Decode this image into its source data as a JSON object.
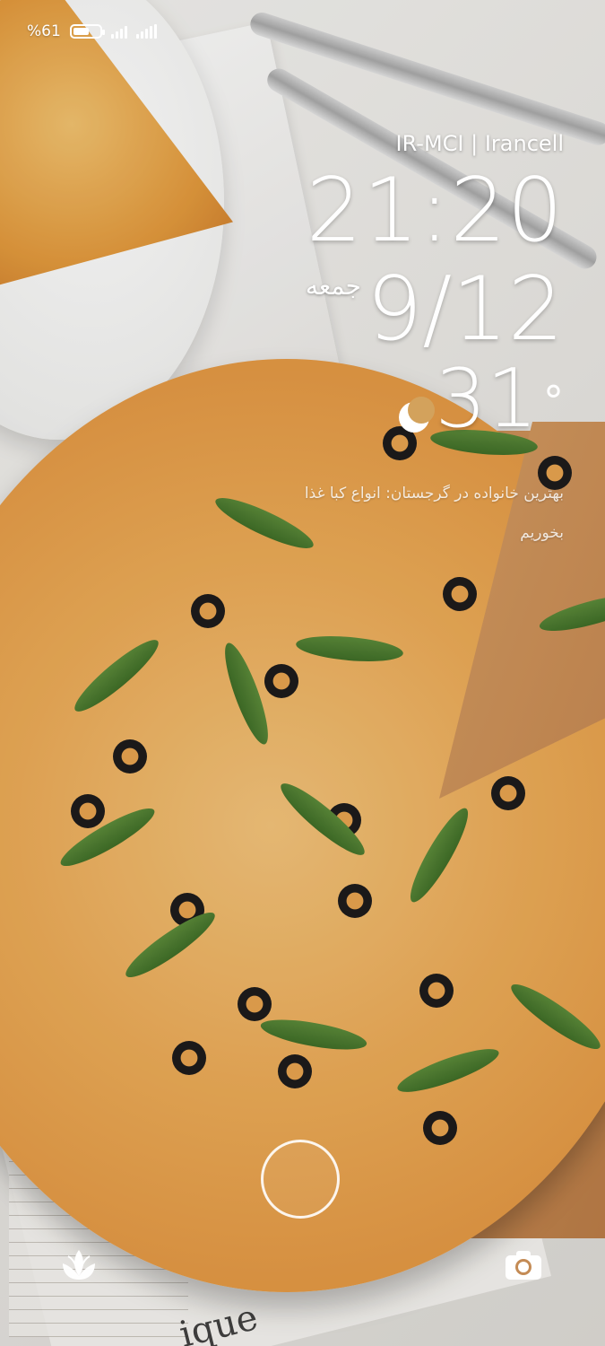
{
  "status_bar": {
    "battery_text": "%61",
    "battery_level": 0.61
  },
  "lock_screen": {
    "carrier": "IR-MCI | Irancell",
    "time": "21:20",
    "weekday": "جمعه",
    "date": "9/12",
    "temperature": "31",
    "degree_symbol": "°",
    "weather_icon": "moon-icon",
    "headline_line1": "بهترین خانواده در گرجستان: انواع کبا غذا",
    "headline_line2": "بخوریم"
  },
  "bottom_bar": {
    "left_icon": "gallery-icon",
    "center_icon": "fingerprint-ring",
    "right_icon": "camera-icon"
  },
  "wallpaper": {
    "menu_word": "ique"
  }
}
